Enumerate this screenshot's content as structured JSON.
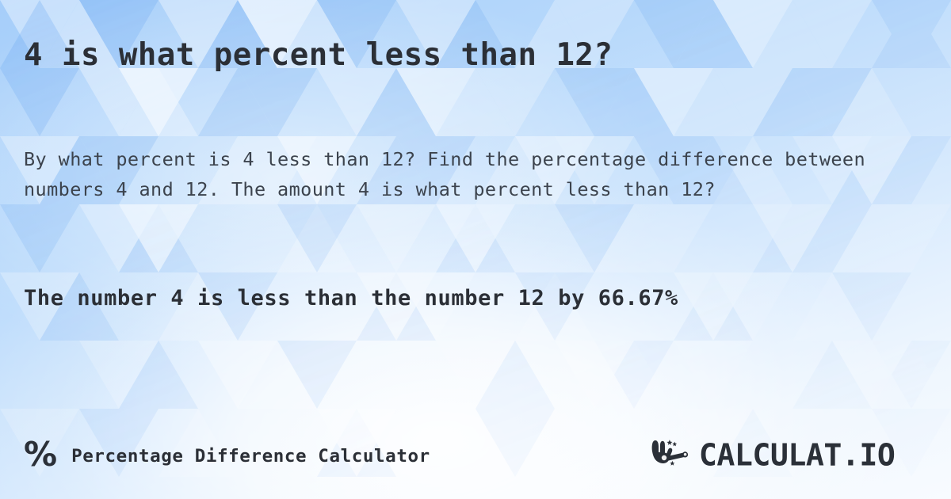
{
  "page": {
    "title": "4 is what percent less than 12?",
    "description": "By what percent is 4 less than 12? Find the percentage difference between numbers 4 and 12. The amount 4 is what percent less than 12?",
    "result": "The number 4 is less than the number 12 by 66.67%"
  },
  "values": {
    "number_a": "4",
    "number_b": "12",
    "percent_difference": "66.67%"
  },
  "footer": {
    "percent_symbol": "%",
    "brand_label": "Percentage Difference Calculator",
    "logo_text": "CALCULAT.IO",
    "logo_icon": "hand-magic-wand-icon"
  },
  "colors": {
    "text_primary": "#2b2f36",
    "text_body": "#3c434d",
    "background_blue": "#a6cefa",
    "background_light": "#f8fbff"
  }
}
